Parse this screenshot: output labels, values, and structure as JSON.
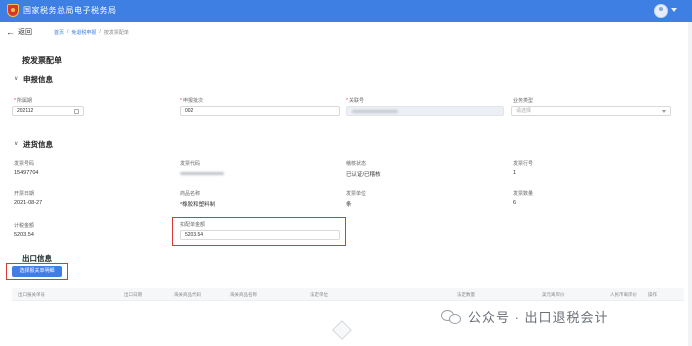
{
  "header": {
    "app_title": "国家税务总局电子税务局",
    "logo_icon": "tax-emblem-icon",
    "avatar_icon": "user-avatar-icon",
    "brand_color": "#3d7fe2"
  },
  "nav": {
    "back_label": "返回",
    "breadcrumb": [
      "首页",
      "免退税申报",
      "按发票配单"
    ]
  },
  "page": {
    "title": "按发票配单"
  },
  "declare_section": {
    "title": "申报信息",
    "fields": [
      {
        "label": "所属期",
        "required": true,
        "value": "202112",
        "type": "date"
      },
      {
        "label": "申报批次",
        "required": true,
        "value": "002",
        "type": "text"
      },
      {
        "label": "关联号",
        "required": true,
        "value": "",
        "type": "disabled-redacted"
      },
      {
        "label": "业务类型",
        "required": false,
        "value": "",
        "placeholder": "请选择",
        "type": "select"
      }
    ]
  },
  "purchase_section": {
    "title": "进货信息",
    "row1": [
      {
        "label": "发票号码",
        "value": "15497704"
      },
      {
        "label": "发票代码",
        "value": ""
      },
      {
        "label": "稽核状态",
        "value": "已认证/已稽核"
      },
      {
        "label": "发票行号",
        "value": "1"
      }
    ],
    "row2": [
      {
        "label": "开票日期",
        "value": "2021-08-27"
      },
      {
        "label": "商品名称",
        "value": "*橡胶和塑料制"
      },
      {
        "label": "发票单位",
        "value": "条"
      },
      {
        "label": "发票数量",
        "value": "6"
      }
    ],
    "row3": [
      {
        "label": "计税金额",
        "value": "5203.54"
      },
      {
        "label": "扣配单金额",
        "value": "5203.54"
      }
    ]
  },
  "export_section": {
    "title": "出口信息",
    "select_button": "选择报关单明细",
    "columns": [
      "出口报关单号",
      "出口日期",
      "海关商品代码",
      "海关商品名称",
      "法定单位",
      "法定数量",
      "美元离岸价",
      "人民币离岸价",
      "操作"
    ],
    "empty_icon": "empty-box-icon"
  },
  "watermark": {
    "text": "公众号 · 出口退税会计",
    "icon": "wechat-icon"
  },
  "highlight_color": "#d93838"
}
